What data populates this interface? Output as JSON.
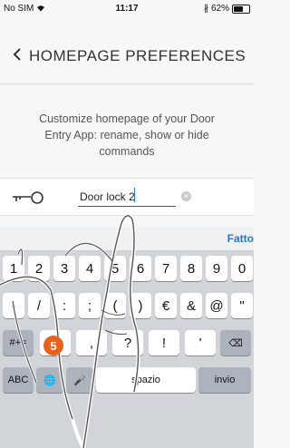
{
  "status_bar": {
    "carrier": "No SIM",
    "time": "11:17",
    "battery_text": "62%",
    "battery_level": 0.62,
    "wifi_icon": "wifi-icon",
    "bluetooth_icon": "bluetooth-icon"
  },
  "header": {
    "title": "HOMEPAGE PREFERENCES",
    "back_icon": "chevron-left-icon"
  },
  "description": "Customize homepage of your Door Entry App: rename, show or hide commands",
  "field": {
    "icon": "key-icon",
    "value": "Door lock 2",
    "clear_icon": "clear-icon"
  },
  "keyboard": {
    "done_label": "Fatto",
    "row1": [
      "1",
      "2",
      "3",
      "4",
      "5",
      "6",
      "7",
      "8",
      "9",
      "0"
    ],
    "row2": [
      "-",
      "/",
      ":",
      ";",
      "(",
      ")",
      "€",
      "&",
      "@",
      "\""
    ],
    "row3_left": "#+=",
    "row3": [
      ".",
      ",",
      "?",
      "!",
      "'"
    ],
    "delete_icon": "backspace-icon",
    "row4": {
      "abc": "ABC",
      "globe_icon": "globe-icon",
      "mic_icon": "microphone-icon",
      "space": "spazio",
      "return": "invio"
    }
  },
  "annotation": {
    "step_number": "5",
    "hand_icon": "pointing-hand-icon"
  },
  "colors": {
    "accent": "#2a77d1",
    "badge": "#e8621e",
    "keyboard_bg": "#d1d4d9"
  }
}
